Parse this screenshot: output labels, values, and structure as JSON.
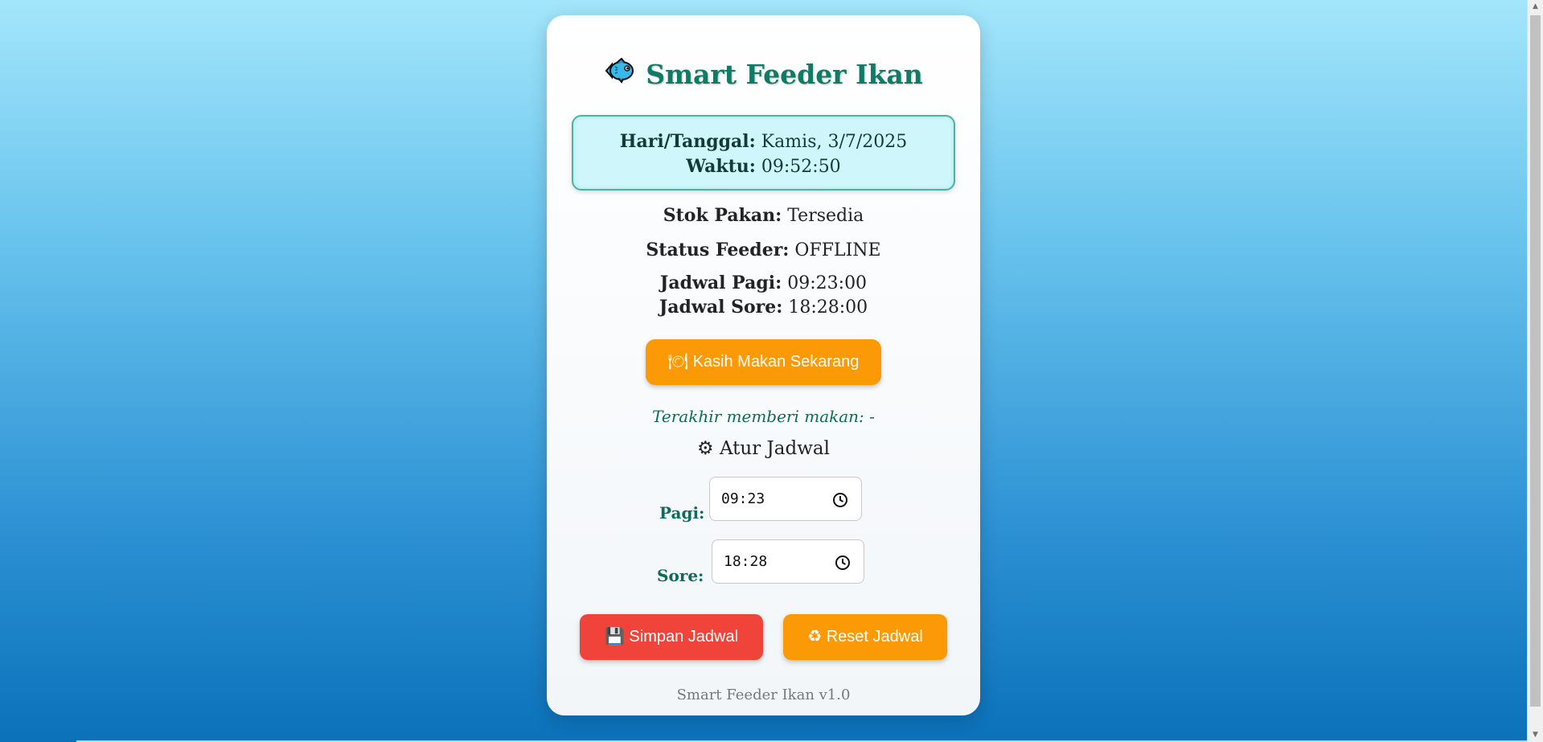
{
  "app": {
    "title": "Smart Feeder Ikan",
    "fish_icon": "fish-icon"
  },
  "datetime": {
    "date_label": "Hari/Tanggal:",
    "date_value": "Kamis, 3/7/2025",
    "time_label": "Waktu:",
    "time_value": "09:52:50"
  },
  "status": {
    "stock_label": "Stok Pakan:",
    "stock_value": "Tersedia",
    "feeder_label": "Status Feeder:",
    "feeder_value": "OFFLINE",
    "morning_label": "Jadwal Pagi:",
    "morning_value": "09:23:00",
    "evening_label": "Jadwal Sore:",
    "evening_value": "18:28:00"
  },
  "actions": {
    "feed_now_icon": "🍽",
    "feed_now_label": "Kasih Makan Sekarang",
    "last_fed": "Terakhir memberi makan: -"
  },
  "schedule": {
    "heading_icon": "⚙",
    "heading": "Atur Jadwal",
    "morning_label": "Pagi:",
    "morning_value": "09:23",
    "evening_label": "Sore:",
    "evening_value": "18:28",
    "save_icon": "💾",
    "save_label": "Simpan Jadwal",
    "reset_icon": "♻",
    "reset_label": "Reset Jadwal"
  },
  "footer": "Smart Feeder Ikan v1.0",
  "colors": {
    "title": "#0f7a66",
    "orange_button": "#fb9906",
    "red_button": "#f0443a",
    "info_box_bg": "#cff7fb",
    "info_box_border": "#49b4a5"
  }
}
